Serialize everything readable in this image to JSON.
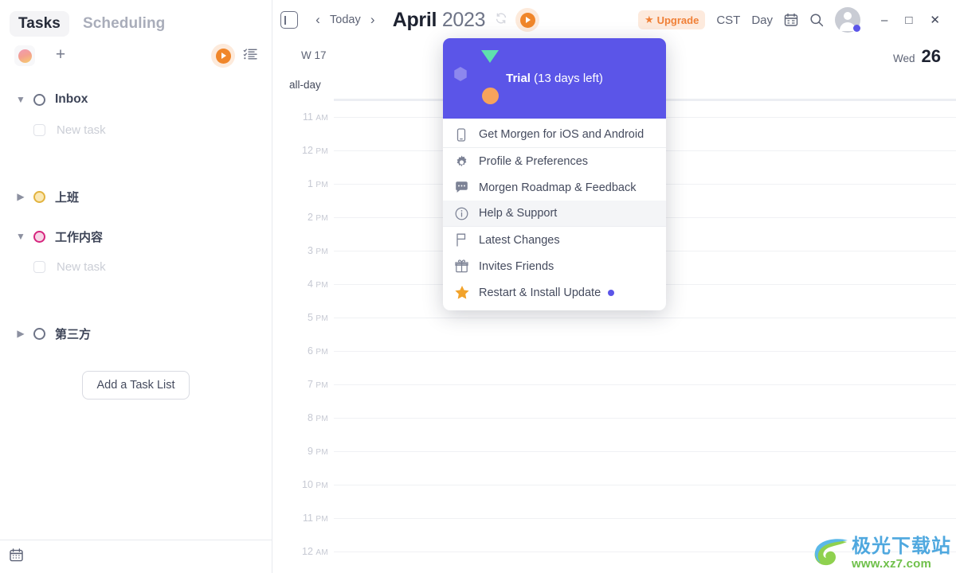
{
  "sidebar": {
    "tabs": [
      {
        "label": "Tasks",
        "active": true
      },
      {
        "label": "Scheduling",
        "active": false
      }
    ],
    "actions": {
      "color_swatch": "color-dot",
      "add_label": "+",
      "play_icon": "play-icon",
      "checklist_icon": "checklist-icon"
    },
    "lists": [
      {
        "label": "Inbox",
        "expanded": true,
        "circle": "outline",
        "new_task": "New task"
      },
      {
        "label": "上班",
        "expanded": false,
        "circle": "yellow",
        "new_task": null
      },
      {
        "label": "工作内容",
        "expanded": true,
        "circle": "pink",
        "new_task": "New task"
      },
      {
        "label": "第三方",
        "expanded": false,
        "circle": "outline",
        "new_task": null
      }
    ],
    "add_list_button": "Add a Task List",
    "footer_icon": "calendar-icon"
  },
  "toolbar": {
    "panel_toggle": "sidebar-toggle-icon",
    "prev": "‹",
    "today": "Today",
    "next": "›",
    "month": "April",
    "year": "2023",
    "sync_icon": "sync-icon",
    "play_icon": "play-icon",
    "upgrade": "Upgrade",
    "timezone": "CST",
    "view": "Day",
    "calendar_icon": "calendar-icon",
    "search_icon": "search-icon",
    "avatar": "user-avatar",
    "minimize": "–",
    "maximize": "□",
    "close": "✕"
  },
  "calendar": {
    "week_label": "W 17",
    "day_of_week": "Wed",
    "day_number": "26",
    "all_day_label": "all-day",
    "hours": [
      {
        "time": "11",
        "ap": "AM"
      },
      {
        "time": "12",
        "ap": "PM"
      },
      {
        "time": "1",
        "ap": "PM"
      },
      {
        "time": "2",
        "ap": "PM"
      },
      {
        "time": "3",
        "ap": "PM"
      },
      {
        "time": "4",
        "ap": "PM"
      },
      {
        "time": "5",
        "ap": "PM"
      },
      {
        "time": "6",
        "ap": "PM"
      },
      {
        "time": "7",
        "ap": "PM"
      },
      {
        "time": "8",
        "ap": "PM"
      },
      {
        "time": "9",
        "ap": "PM"
      },
      {
        "time": "10",
        "ap": "PM"
      },
      {
        "time": "11",
        "ap": "PM"
      },
      {
        "time": "12",
        "ap": "AM"
      }
    ]
  },
  "menu": {
    "header": {
      "plan": "Trial",
      "note": " (13 days left)"
    },
    "items": [
      {
        "label": "Get Morgen for iOS and Android",
        "icon": "phone-icon",
        "highlight": false,
        "separator": true,
        "badge": false
      },
      {
        "label": "Profile & Preferences",
        "icon": "gear-icon",
        "highlight": false,
        "separator": false,
        "badge": false
      },
      {
        "label": "Morgen Roadmap & Feedback",
        "icon": "chat-icon",
        "highlight": false,
        "separator": false,
        "badge": false
      },
      {
        "label": "Help & Support",
        "icon": "info-icon",
        "highlight": true,
        "separator": true,
        "badge": false
      },
      {
        "label": "Latest Changes",
        "icon": "flag-icon",
        "highlight": false,
        "separator": false,
        "badge": false
      },
      {
        "label": "Invites Friends",
        "icon": "gift-icon",
        "highlight": false,
        "separator": false,
        "badge": false
      },
      {
        "label": "Restart & Install Update",
        "icon": "star-icon",
        "highlight": false,
        "separator": false,
        "badge": true
      }
    ]
  },
  "watermark": {
    "name": "极光下载站",
    "url": "www.xz7.com"
  },
  "colors": {
    "accent_purple": "#5b55e8",
    "accent_orange": "#f0862a",
    "upgrade_bg": "#fdeadd",
    "upgrade_fg": "#f08037"
  }
}
